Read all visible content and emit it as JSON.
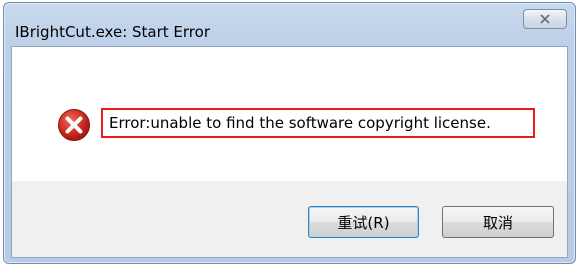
{
  "window": {
    "title": "IBrightCut.exe: Start Error"
  },
  "message": {
    "icon": "error-icon",
    "text": "Error:unable to find the software copyright license."
  },
  "buttons": {
    "retry_label": "重试(R)",
    "cancel_label": "取消"
  },
  "colors": {
    "highlight_border": "#e81c1c",
    "error_icon_red": "#c6221d"
  }
}
